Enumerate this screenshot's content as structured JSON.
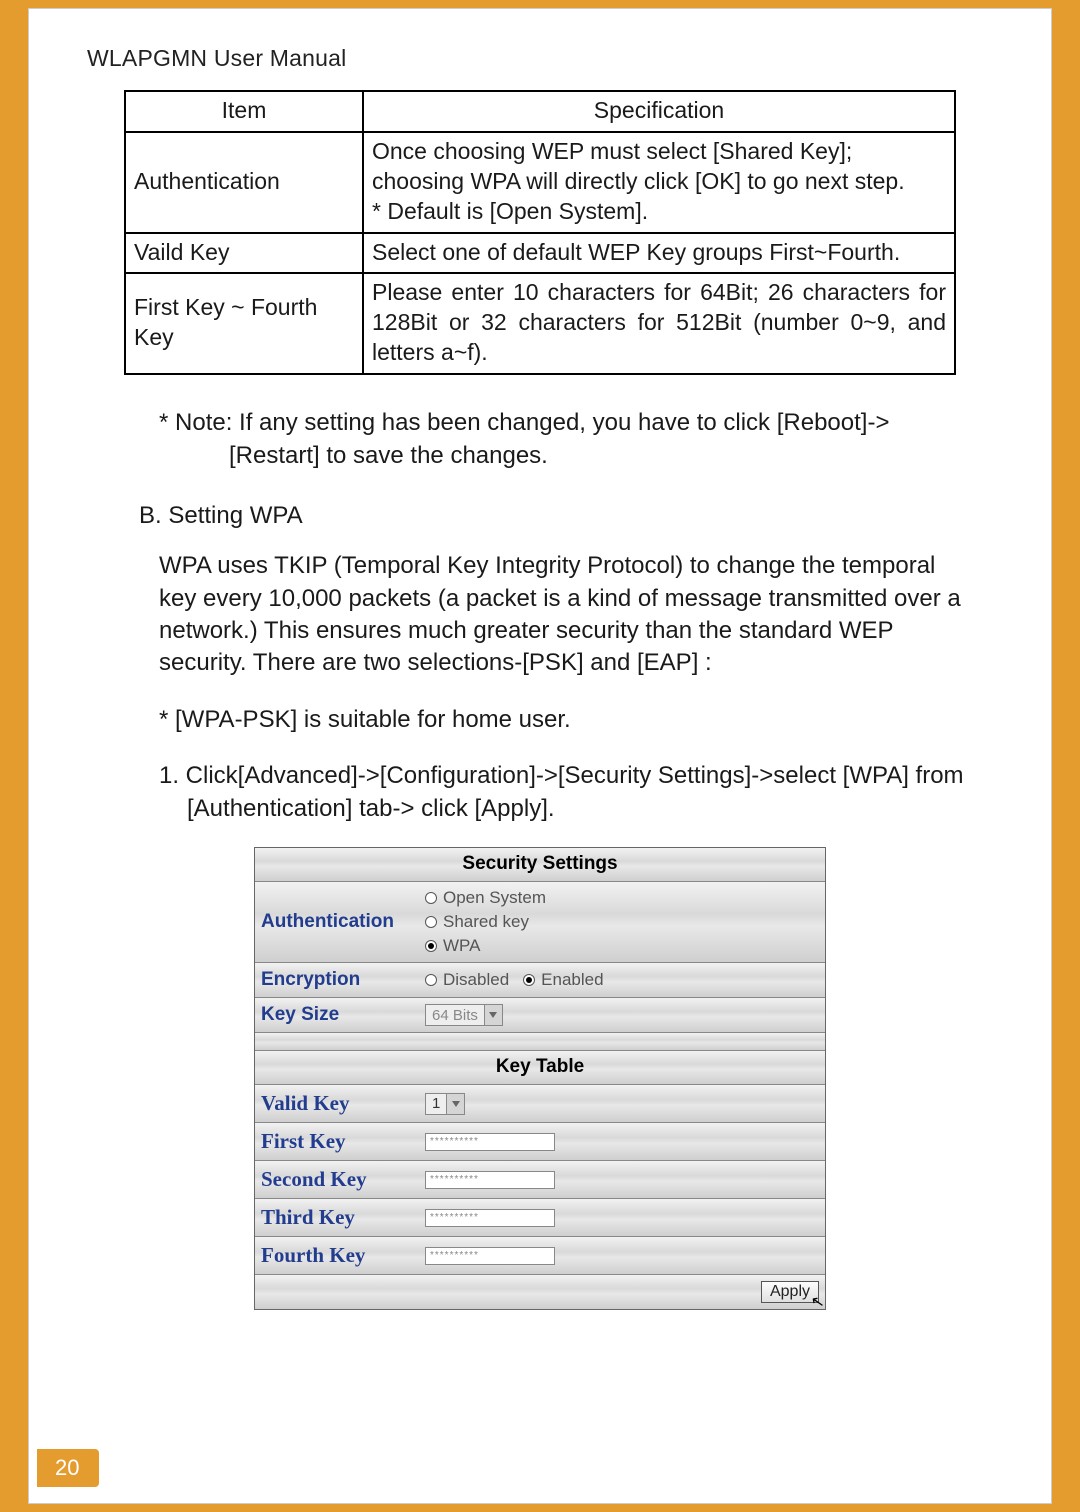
{
  "running_head": "WLAPGMN User Manual",
  "page_number": "20",
  "spec_table": {
    "headers": {
      "item": "Item",
      "spec": "Specification"
    },
    "rows": [
      {
        "item": "Authentication",
        "spec": "Once choosing WEP must select [Shared Key]; choosing WPA will directly click [OK] to go next step.\n* Default is [Open System]."
      },
      {
        "item": "Vaild Key",
        "spec": "Select one of default WEP Key groups First~Fourth."
      },
      {
        "item": "First Key ~ Fourth Key",
        "spec": "Please enter 10 characters for 64Bit; 26 characters for 128Bit or 32 characters for 512Bit (number 0~9, and letters a~f)."
      }
    ]
  },
  "note": "* Note: If any setting has been changed, you have to click [Reboot]->[Restart] to save the changes.",
  "section_heading": "B. Setting WPA",
  "wpa_para": "WPA uses TKIP (Temporal Key Integrity Protocol) to change the temporal key every 10,000 packets (a packet is a kind of message transmitted over a network.) This ensures much greater security than the standard WEP security. There are two selections-[PSK] and [EAP] :",
  "psk_note": "* [WPA-PSK] is suitable for home user.",
  "step1": "1.  Click[Advanced]->[Configuration]->[Security Settings]->select [WPA] from [Authentication] tab-> click [Apply].",
  "panel": {
    "title1": "Security Settings",
    "auth_label": "Authentication",
    "auth_options": {
      "open": "Open System",
      "shared": "Shared key",
      "wpa": "WPA"
    },
    "auth_selected": "wpa",
    "enc_label": "Encryption",
    "enc_options": {
      "disabled": "Disabled",
      "enabled": "Enabled"
    },
    "enc_selected": "enabled",
    "keysize_label": "Key Size",
    "keysize_value": "64 Bits",
    "title2": "Key Table",
    "valid_label": "Valid Key",
    "valid_value": "1",
    "key_labels": {
      "first": "First Key",
      "second": "Second Key",
      "third": "Third Key",
      "fourth": "Fourth Key"
    },
    "key_mask": "**********",
    "apply": "Apply"
  }
}
